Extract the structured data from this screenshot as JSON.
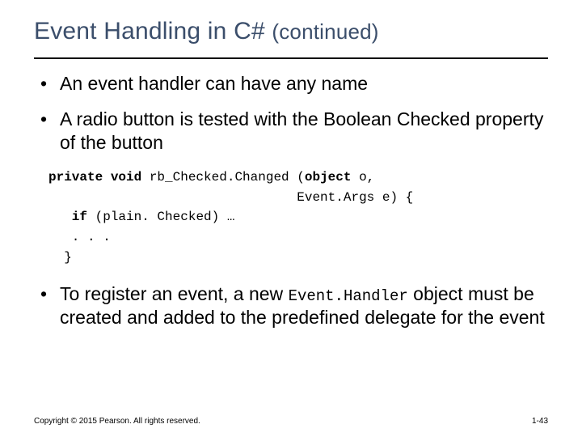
{
  "title_main": "Event Handling in C# ",
  "title_cont": "(continued)",
  "bullets": {
    "b1": "An event handler can have any name",
    "b2": "A radio button is tested with the Boolean Checked property of the button",
    "b3_pre": "To register an event, a new ",
    "b3_code": "Event.Handler",
    "b3_post": " object must be created and added to  the predefined delegate for the event"
  },
  "code": {
    "l1_kw1": "private void",
    "l1_mid": " rb_Checked.Changed (",
    "l1_kw2": "object",
    "l1_end": " o,",
    "l2": "                                Event.Args e) {",
    "l3_kw": "   if",
    "l3_rest": " (plain. Checked) …",
    "l4": "   . . .",
    "l5": "  }"
  },
  "footer": {
    "copyright": "Copyright © 2015 Pearson. All rights reserved.",
    "pagenum": "1-43"
  }
}
